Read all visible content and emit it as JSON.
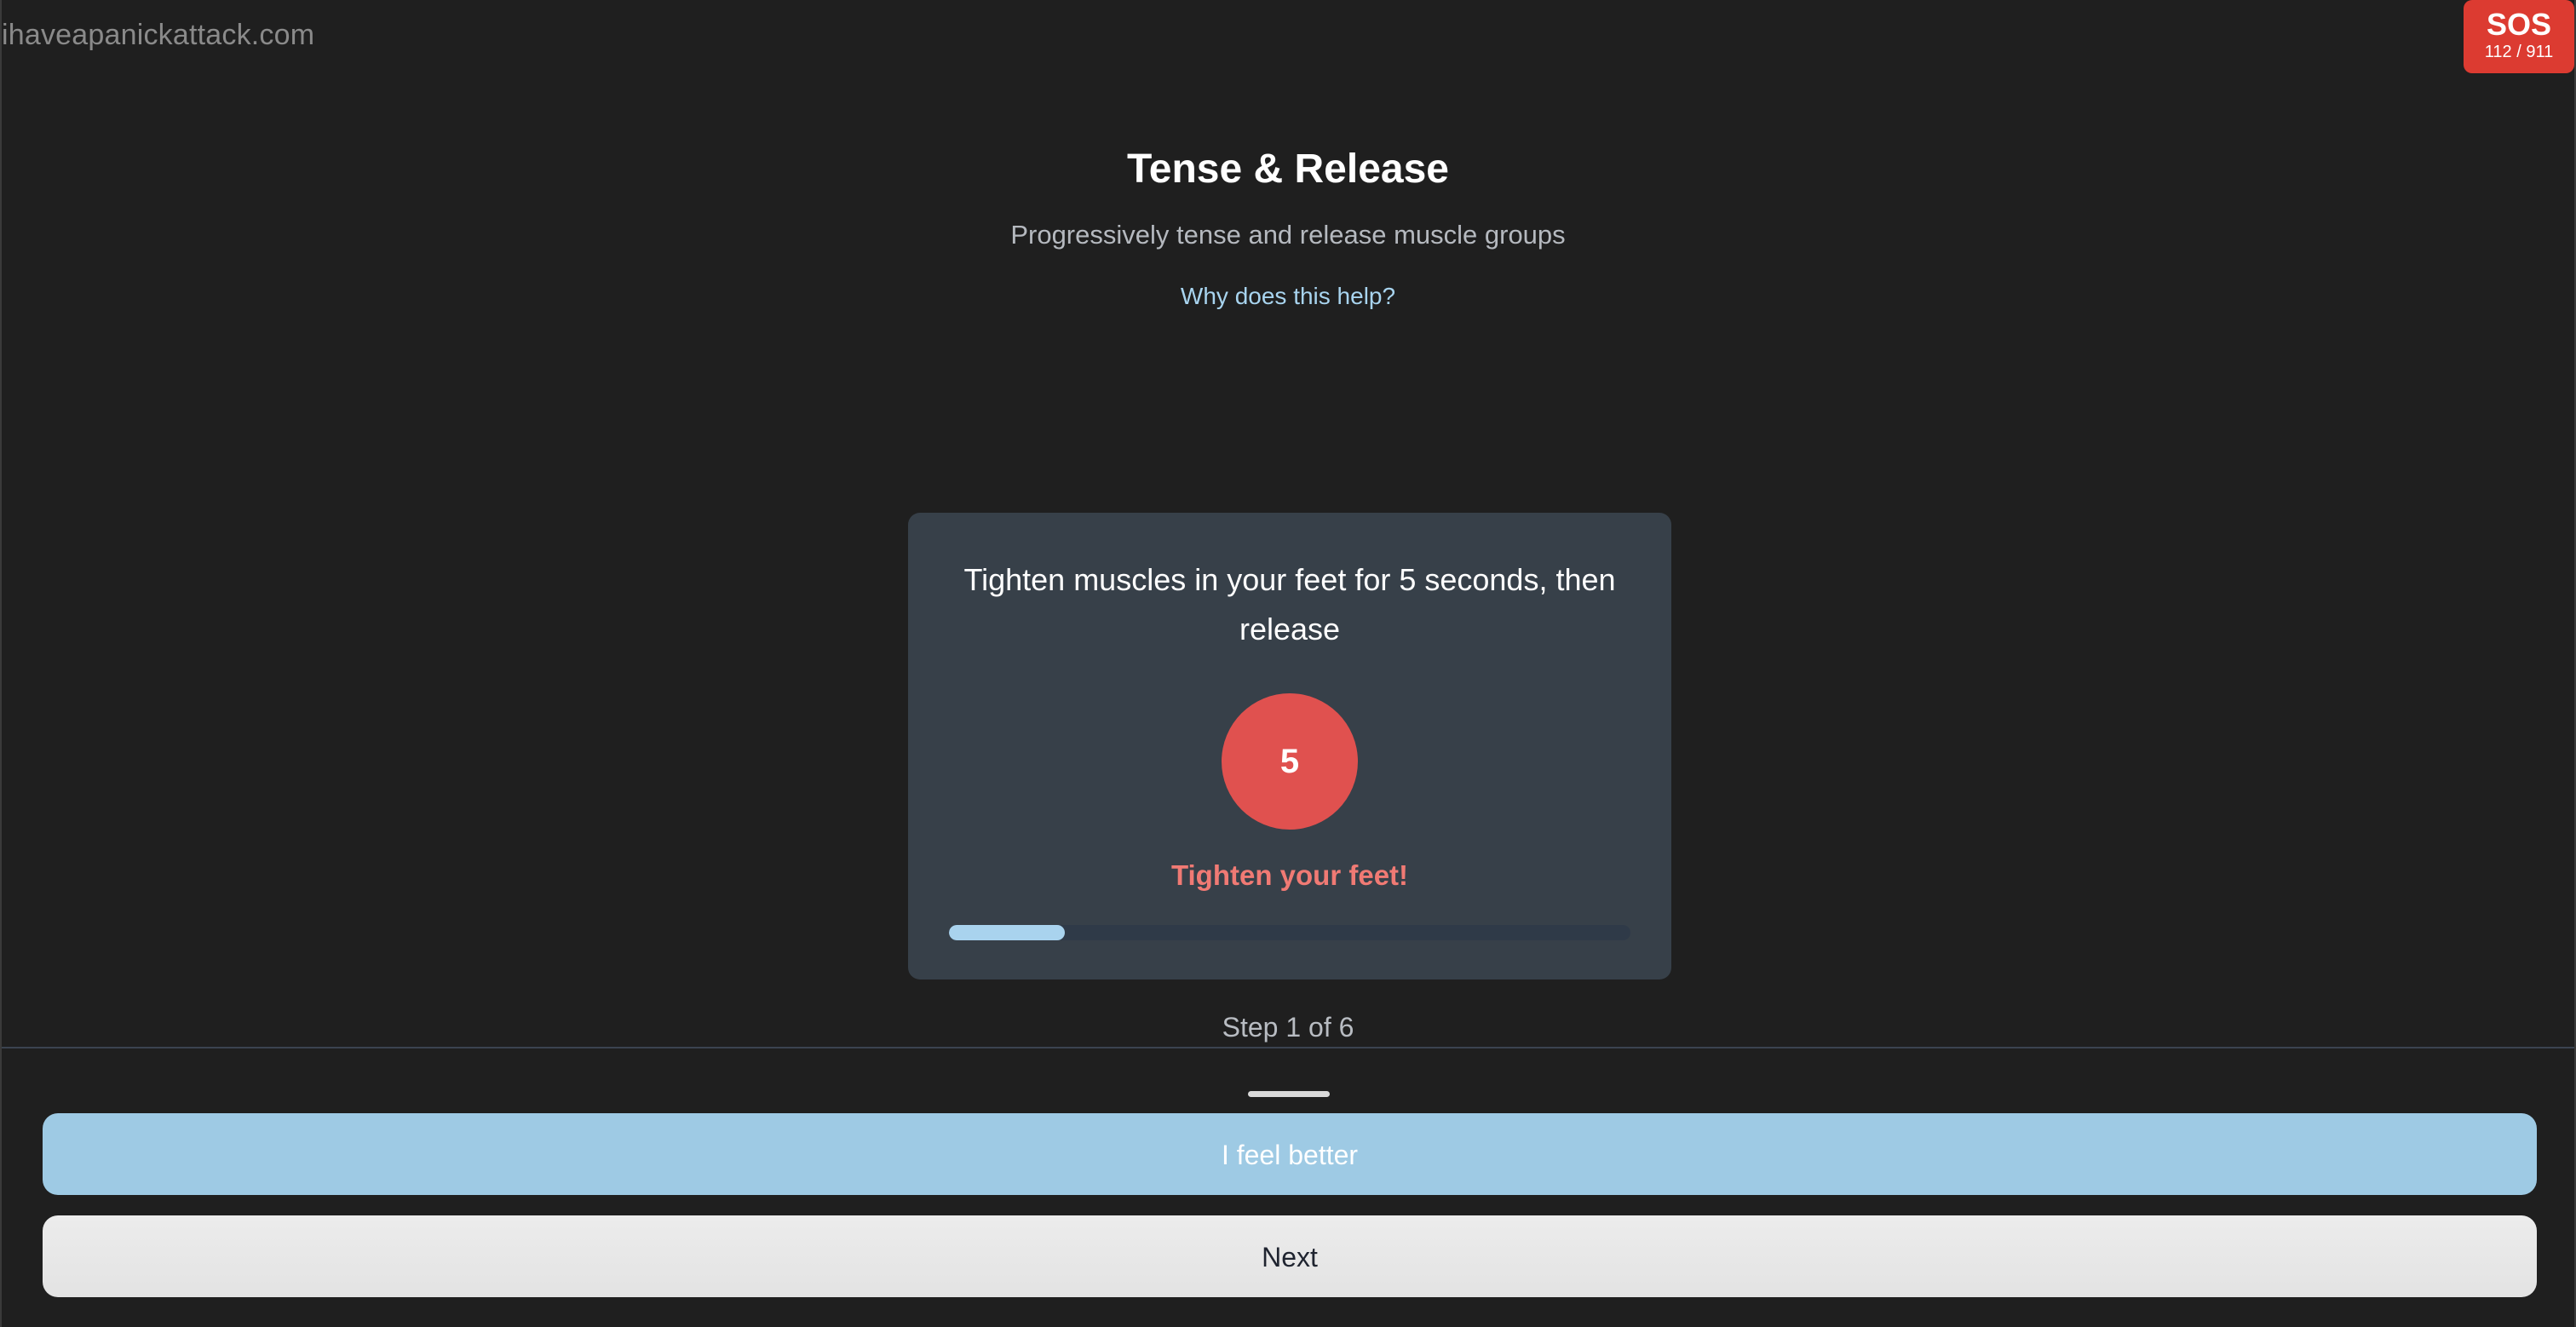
{
  "site": {
    "name": "ihaveapanickattack.com"
  },
  "sos": {
    "label": "SOS",
    "numbers": "112 / 911",
    "color": "#dc3b31"
  },
  "exercise": {
    "title": "Tense & Release",
    "subtitle": "Progressively tense and release muscle groups",
    "why_link": "Why does this help?"
  },
  "card": {
    "instruction": "Tighten muscles in your feet for 5 seconds, then release",
    "timer_value": "5",
    "action_text": "Tighten your feet!",
    "progress_fraction": 0.17
  },
  "step": {
    "text": "Step 1 of 6"
  },
  "buttons": {
    "feel_better": "I feel better",
    "next": "Next"
  },
  "colors": {
    "background": "#1f1f1f",
    "card": "#374049",
    "timer": "#e0514f",
    "action_text": "#f07a74",
    "accent": "#9ecae4",
    "link": "#a8d4ef"
  }
}
